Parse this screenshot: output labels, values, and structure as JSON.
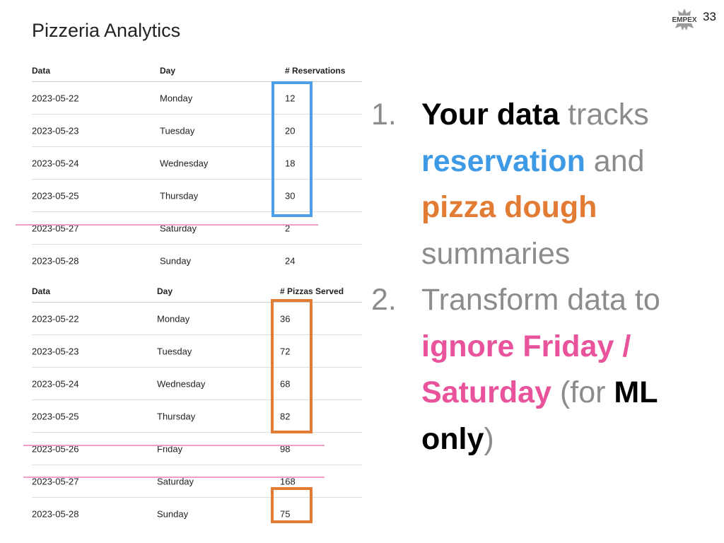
{
  "slide": {
    "title": "Pizzeria Analytics",
    "slide_number": "33",
    "logo_text": "EMPEX"
  },
  "reservations_table": {
    "headers": [
      "Data",
      "Day",
      "# Reservations"
    ],
    "rows": [
      [
        "2023-05-22",
        "Monday",
        "12"
      ],
      [
        "2023-05-23",
        "Tuesday",
        "20"
      ],
      [
        "2023-05-24",
        "Wednesday",
        "18"
      ],
      [
        "2023-05-25",
        "Thursday",
        "30"
      ],
      [
        "2023-05-27",
        "Saturday",
        "2"
      ],
      [
        "2023-05-28",
        "Sunday",
        "24"
      ]
    ]
  },
  "pizzas_table": {
    "headers": [
      "Data",
      "Day",
      "# Pizzas Served"
    ],
    "rows": [
      [
        "2023-05-22",
        "Monday",
        "36"
      ],
      [
        "2023-05-23",
        "Tuesday",
        "72"
      ],
      [
        "2023-05-24",
        "Wednesday",
        "68"
      ],
      [
        "2023-05-25",
        "Thursday",
        "82"
      ],
      [
        "2023-05-26",
        "Friday",
        "98"
      ],
      [
        "2023-05-27",
        "Saturday",
        "168"
      ],
      [
        "2023-05-28",
        "Sunday",
        "75"
      ]
    ]
  },
  "points": {
    "p1_num": "1.",
    "p1_a": "Your data",
    "p1_b": " tracks ",
    "p1_c": "reservation",
    "p1_d": " and ",
    "p1_e": "pizza dough",
    "p1_f": " summaries",
    "p2_num": "2.",
    "p2_a": "Transform data to ",
    "p2_b": "ignore Friday / Saturday",
    "p2_c": " (for ",
    "p2_d": "ML only",
    "p2_e": ")"
  },
  "colors": {
    "reservation_blue": "#3f9ae6",
    "dough_orange": "#e27b33",
    "ignore_pink": "#e8539c",
    "strike_pink": "#f19fc8",
    "muted_gray": "#8c8c8c"
  }
}
